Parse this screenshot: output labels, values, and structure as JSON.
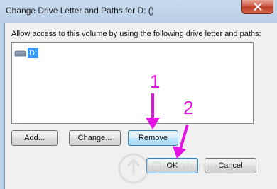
{
  "window": {
    "title": "Change Drive Letter and Paths for D: ()",
    "close_icon": "close-icon"
  },
  "dialog": {
    "instruction": "Allow access to this volume by using the following drive letter and paths:",
    "list_items": [
      {
        "icon": "drive-icon",
        "label": "D:",
        "selected": true
      }
    ],
    "buttons": {
      "add": "Add...",
      "change": "Change...",
      "remove": "Remove",
      "ok": "OK",
      "cancel": "Cancel"
    }
  },
  "annotations": {
    "step1": "1",
    "step2": "2",
    "color": "#e514e5"
  },
  "watermark": {
    "text": "Quantrimang"
  },
  "colors": {
    "selection": "#3399ff",
    "titlebar": "#bcd0e6",
    "close_button": "#c9523c"
  }
}
